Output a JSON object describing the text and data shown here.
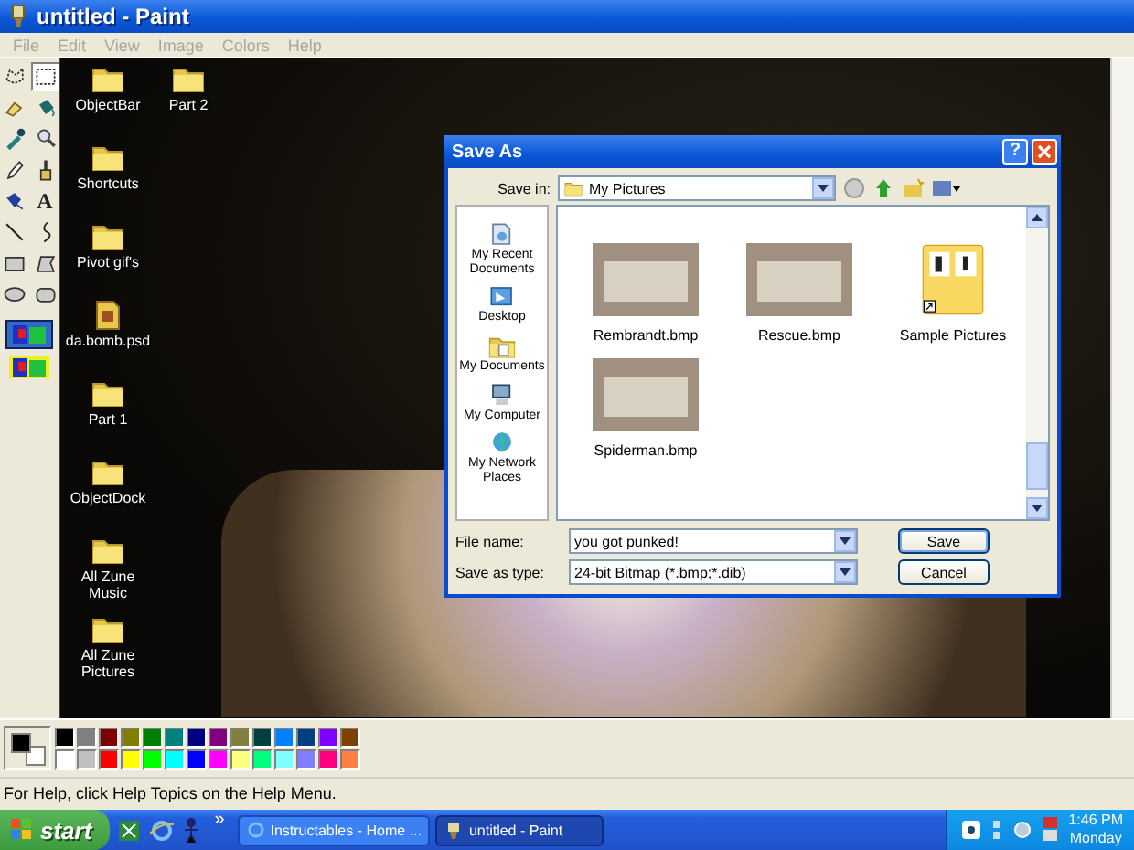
{
  "window": {
    "title": "untitled - Paint"
  },
  "menu": [
    "File",
    "Edit",
    "View",
    "Image",
    "Colors",
    "Help"
  ],
  "tools": [
    {
      "kind": "free-select",
      "selected": false
    },
    {
      "kind": "select",
      "selected": true
    },
    {
      "kind": "eraser",
      "selected": false
    },
    {
      "kind": "fill",
      "selected": false
    },
    {
      "kind": "picker",
      "selected": false
    },
    {
      "kind": "magnifier",
      "selected": false
    },
    {
      "kind": "pencil",
      "selected": false
    },
    {
      "kind": "brush",
      "selected": false
    },
    {
      "kind": "airbrush",
      "selected": false
    },
    {
      "kind": "text",
      "label": "A",
      "selected": false
    },
    {
      "kind": "line",
      "selected": false
    },
    {
      "kind": "curve",
      "selected": false
    },
    {
      "kind": "rectangle",
      "selected": false
    },
    {
      "kind": "polygon",
      "selected": false
    },
    {
      "kind": "ellipse",
      "selected": false
    },
    {
      "kind": "rounded-rectangle",
      "selected": false
    }
  ],
  "tool_options": [
    {
      "selected": true
    },
    {
      "selected": false
    }
  ],
  "canvas": {
    "desktop_icons": [
      {
        "label": "ObjectBar",
        "kind": "folder"
      },
      {
        "label": "Shortcuts",
        "kind": "folder"
      },
      {
        "label": "Pivot gif's",
        "kind": "folder"
      },
      {
        "label": "da.bomb.psd",
        "kind": "file"
      },
      {
        "label": "Part 1",
        "kind": "folder"
      },
      {
        "label": "ObjectDock",
        "kind": "folder"
      },
      {
        "label": "All Zune Music",
        "kind": "folder"
      },
      {
        "label": "All Zune Pictures",
        "kind": "folder"
      },
      {
        "label": "Part 2",
        "kind": "folder"
      }
    ]
  },
  "dialog": {
    "title": "Save As",
    "help_button": "?",
    "save_in_label": "Save in:",
    "save_in_value": "My Pictures",
    "places": [
      "My Recent Documents",
      "Desktop",
      "My Documents",
      "My Computer",
      "My Network Places"
    ],
    "files": [
      {
        "name": "Rembrandt.bmp",
        "kind": "image"
      },
      {
        "name": "Rescue.bmp",
        "kind": "image"
      },
      {
        "name": "Sample Pictures",
        "kind": "folder-shortcut"
      },
      {
        "name": "Spiderman.bmp",
        "kind": "image"
      }
    ],
    "file_name_label": "File name:",
    "file_name": "you got punked!",
    "type_label": "Save as type:",
    "type_value": "24-bit Bitmap (*.bmp;*.dib)",
    "buttons": [
      "Save",
      "Cancel"
    ]
  },
  "palette": {
    "current": [
      {
        "color": "#000000"
      },
      {
        "color": "#ffffff"
      }
    ],
    "colors": [
      {
        "color": "#000000"
      },
      {
        "color": "#808080"
      },
      {
        "color": "#800000"
      },
      {
        "color": "#808000"
      },
      {
        "color": "#008000"
      },
      {
        "color": "#008080"
      },
      {
        "color": "#000080"
      },
      {
        "color": "#800080"
      },
      {
        "color": "#808040"
      },
      {
        "color": "#004040"
      },
      {
        "color": "#0080ff"
      },
      {
        "color": "#004080"
      },
      {
        "color": "#8000ff"
      },
      {
        "color": "#804000"
      },
      {
        "color": "#ffffff"
      },
      {
        "color": "#c0c0c0"
      },
      {
        "color": "#ff0000"
      },
      {
        "color": "#ffff00"
      },
      {
        "color": "#00ff00"
      },
      {
        "color": "#00ffff"
      },
      {
        "color": "#0000ff"
      },
      {
        "color": "#ff00ff"
      },
      {
        "color": "#ffff80"
      },
      {
        "color": "#00ff80"
      },
      {
        "color": "#80ffff"
      },
      {
        "color": "#8080ff"
      },
      {
        "color": "#ff0080"
      },
      {
        "color": "#ff8040"
      }
    ]
  },
  "status_bar": "For Help, click Help Topics on the Help Menu.",
  "taskbar": {
    "start": "start",
    "more": "»",
    "tasks": [
      {
        "label": "Instructables - Home ...",
        "selected": false
      },
      {
        "label": "untitled - Paint",
        "selected": true
      }
    ],
    "clock": "1:46 PM",
    "day": "Monday"
  }
}
